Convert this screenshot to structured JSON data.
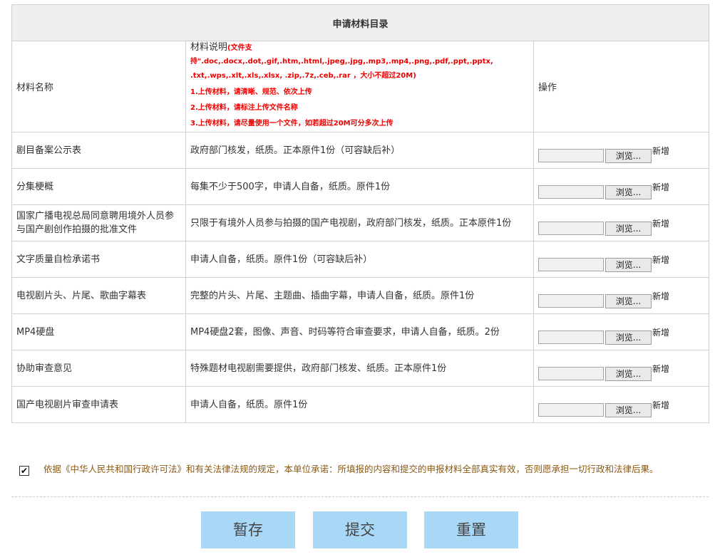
{
  "table": {
    "title": "申请材料目录",
    "headers": {
      "name": "材料名称",
      "desc_label": "材料说明",
      "desc_note_line1": "(文件支持\".doc,.docx,.dot,.gif,.htm,.html,.jpeg,.jpg,.mp3,.mp4,.png,.pdf,.ppt,.pptx,",
      "desc_note_line2": ".txt,.wps,.xlt,.xls,.xlsx, .zip,.7z,.ceb,.rar ，大小不超过20M)",
      "rules": [
        "1.上传材料，请清晰、规范、依次上传",
        "2.上传材料，请标注上传文件名称",
        "3.上传材料，请尽量使用一个文件，如若超过20M可分多次上传"
      ],
      "action": "操作"
    },
    "rows": [
      {
        "name": "剧目备案公示表",
        "desc": "政府部门核发，纸质。正本原件1份（可容缺后补）"
      },
      {
        "name": "分集梗概",
        "desc": "每集不少于500字，申请人自备，纸质。原件1份"
      },
      {
        "name": "国家广播电视总局同意聘用境外人员参与国产剧创作拍摄的批准文件",
        "desc": "只限于有境外人员参与拍摄的国产电视剧，政府部门核发，纸质。正本原件1份"
      },
      {
        "name": "文字质量自检承诺书",
        "desc": "申请人自备，纸质。原件1份（可容缺后补）"
      },
      {
        "name": "电视剧片头、片尾、歌曲字幕表",
        "desc": "完整的片头、片尾、主题曲、插曲字幕，申请人自备，纸质。原件1份"
      },
      {
        "name": "MP4硬盘",
        "desc": "MP4硬盘2套，图像、声音、时码等符合审查要求，申请人自备，纸质。2份"
      },
      {
        "name": "协助审查意见",
        "desc": "特殊题材电视剧需要提供，政府部门核发、纸质。正本原件1份"
      },
      {
        "name": "国产电视剧片审查申请表",
        "desc": "申请人自备，纸质。原件1份"
      }
    ],
    "browse_label": "浏览...",
    "add_label": "新增"
  },
  "agreement": {
    "checked": true,
    "check_mark": "✔",
    "text": "依据《中华人民共和国行政许可法》和有关法律法规的规定，本单位承诺：所填报的内容和提交的申报材料全部真实有效，否则愿承担一切行政和法律后果。"
  },
  "buttons": {
    "save": "暂存",
    "submit": "提交",
    "reset": "重置"
  },
  "colors": {
    "button_bg": "#a9d7f6",
    "warning_red": "#ee0000",
    "agreement_text": "#8b5a14"
  }
}
